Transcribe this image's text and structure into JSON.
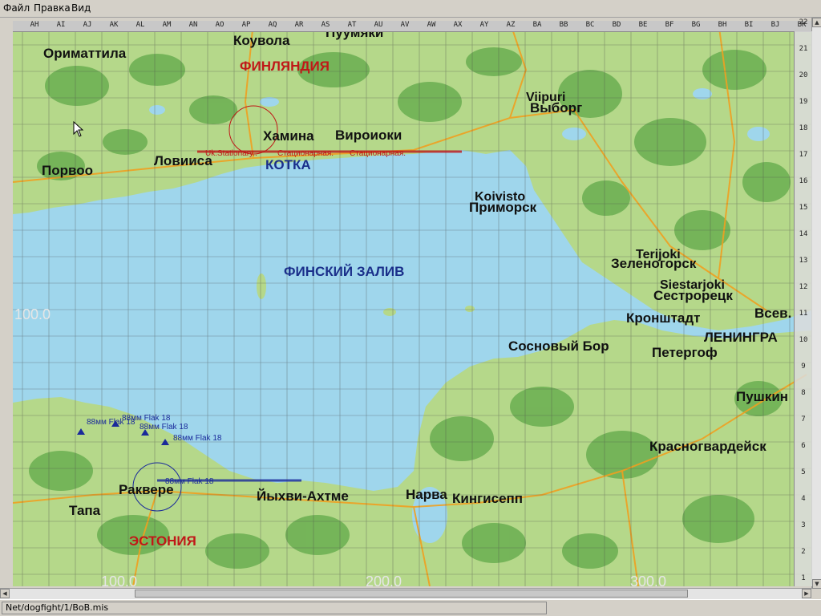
{
  "menu": {
    "file": "Файл",
    "edit": "Правка",
    "view": "Вид"
  },
  "grid": {
    "columns": [
      "AH",
      "AI",
      "AJ",
      "AK",
      "AL",
      "AM",
      "AN",
      "AO",
      "AP",
      "AQ",
      "AR",
      "AS",
      "AT",
      "AU",
      "AV",
      "AW",
      "AX",
      "AY",
      "AZ",
      "BA",
      "BB",
      "BC",
      "BD",
      "BE",
      "BF",
      "BG",
      "BH",
      "BI",
      "BJ",
      "BK"
    ],
    "rows": [
      "22",
      "21",
      "20",
      "19",
      "18",
      "17",
      "16",
      "15",
      "14",
      "13",
      "12",
      "11",
      "10",
      "9",
      "8",
      "7",
      "6",
      "5",
      "4",
      "3",
      "2",
      "1"
    ]
  },
  "map": {
    "coords": {
      "left": "100.0",
      "bottom_left": "100.0",
      "bottom_mid": "200.0",
      "bottom_right": "300.0"
    },
    "countries": {
      "finland": "ФИНЛЯНДИЯ",
      "estonia": "ЭСТОНИЯ"
    },
    "sea": "ФИНСКИЙ ЗАЛИВ",
    "cities": {
      "kouvola": "Коувола",
      "puumala": "Пуумяки",
      "orimattila": "Ориматтила",
      "porvoo": "Порвоо",
      "loviisa": "Ловииса",
      "hamina": "Хамина",
      "virojoki": "Вироиоки",
      "kotka": "КОТКА",
      "viipuri_lat": "Viipuri",
      "vyborg": "Выборг",
      "koivisto_lat": "Koivisto",
      "primorsk": "Приморск",
      "terijoki_lat": "Terijoki",
      "zelenogorsk": "Зеленогорск",
      "siestarjoki_lat": "Siestarjoki",
      "sestroretsk": "Сестрорецк",
      "vsev": "Всев.",
      "kronshtadt": "Кронштадт",
      "leningrad": "ЛЕНИНГРА",
      "sosnovy_bor": "Сосновый Бор",
      "petergof": "Петергоф",
      "pushkin": "Пушкин",
      "krasnogvardeysk": "Красногвардейск",
      "rakvere": "Раквере",
      "tapa": "Тапа",
      "johvi": "Йыхви-Ахтме",
      "narva": "Нарва",
      "kingisepp": "Кингисепп"
    },
    "flak_labels": [
      "88мм Flak 18",
      "88мм Flak 18",
      "88мм Flak 18",
      "88мм Flak 18",
      "88мм Flak 18"
    ],
    "airfield_labels": [
      "Uk.Stationary..",
      "Стационарная.",
      "Стационарная."
    ]
  },
  "status": {
    "path": "Net/dogfight/1/BoB.mis"
  },
  "colors": {
    "water": "#9fd6ec",
    "land": "#b5d88a",
    "forest": "#5aa645",
    "road": "#f0a020",
    "country": "#c01818",
    "sea_label": "#1a2f8a"
  }
}
